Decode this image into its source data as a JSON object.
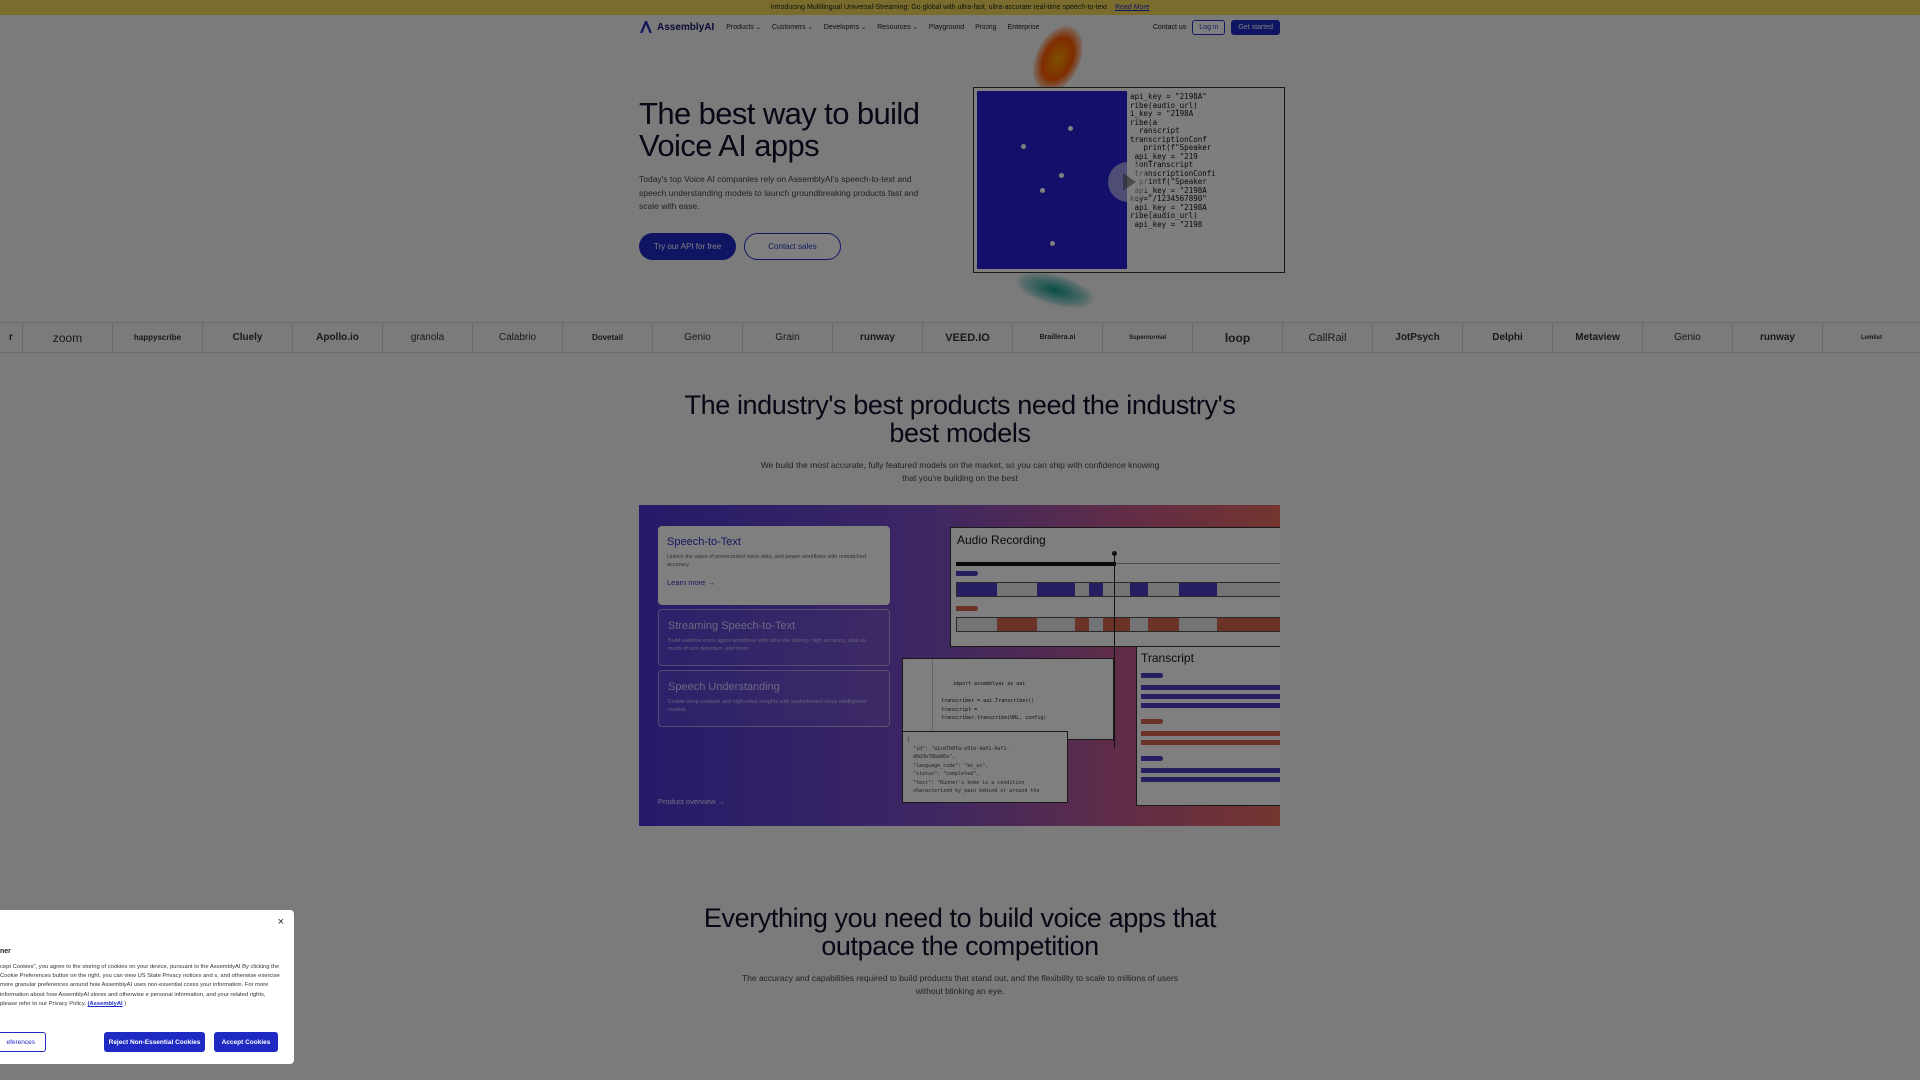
{
  "announcement": {
    "text": "Introducing Multilingual Universal-Streaming: Go global with ultra-fast, ultra-accurate real-time speech-to-text",
    "link": "Read More"
  },
  "nav": {
    "brand": "AssemblyAI",
    "items": [
      "Products",
      "Customers",
      "Developers",
      "Resources",
      "Playground",
      "Pricing",
      "Enterprise"
    ],
    "contact": "Contact us",
    "login": "Log in",
    "get_started": "Get started"
  },
  "hero": {
    "title": "The best way to build Voice AI apps",
    "subtitle": "Today's top Voice AI companies rely on AssemblyAI's speech-to-text and speech understanding models to launch groundbreaking products fast and scale with ease.",
    "cta_primary": "Try our API for free",
    "cta_secondary": "Contact sales",
    "code_text": "api_key = \"2198A\"\nribe(audio_url)\ni_key = \"2198A\nribe(a\n  ranscript\ntranscriptionConf\n   print(f\"Speaker\n api_key = \"219\n ionTranscript\n transcriptionConfi\n  printf(\"Speaker\n api_key = \"2198A\nkey=\"/1234567890\"\n api_key = \"2198A\nribe(audio_url)\n api_key = \"2198"
  },
  "logos": [
    "r",
    "zoom",
    "happyscribe",
    "Cluely",
    "Apollo.io",
    "granola",
    "Calabrio",
    "Dovetail",
    "Genio",
    "Grain",
    "runway",
    "VEED.IO",
    "Braillera.ai",
    "Supernormal",
    "loop",
    "CallRail",
    "JotPsych",
    "Delphi",
    "Metaview",
    "Genio",
    "runway",
    "Lemlist"
  ],
  "section2": {
    "title": "The industry's best products need the industry's best models",
    "subtitle": "We build the most accurate, fully featured models on the market, so you can ship with confidence knowing that you're building on the best",
    "cards": [
      {
        "title": "Speech-to-Text",
        "desc": "Unlock the value of prerecorded voice data, and power workflows with unmatched accuracy.",
        "link": "Learn more →"
      },
      {
        "title": "Streaming Speech-to-Text",
        "desc": "Build realtime voice agent workflows with ultra-low latency, high accuracy, plus as much of turn detection, and more."
      },
      {
        "title": "Speech Understanding",
        "desc": "Enable deep analysis and high-value insights with sophisticated voice intelligence models."
      }
    ],
    "product_overview": "Product overview →",
    "audio_title": "Audio Recording",
    "transcript_title": "Transcript",
    "code_text": "import assemblyai as aai\n\ntranscriber = aai.Transcriber()\ntranscript =\ntranscriber.transcribe(URL, config)\n\nprint(transcript)",
    "output_text": "{\n  \"id\": \"a1cd7b8fa-e91b-4a01-9af1-\n  d0d3b78ba86e\",\n  \"language_code\": \"en_us\",\n  \"status\": \"completed\",\n  \"text\": \"Runner's knee is a condition\n  characterized by pain behind or around the"
  },
  "section3": {
    "title": "Everything you need to build voice apps that outpace the competition",
    "subtitle": "The accuracy and capabilities required to build products that stand out, and the flexibility to scale to millions of users without blinking an eye."
  },
  "cookie": {
    "heading": "ner",
    "body": "cept Cookies\", you agree to the storing of cookies on your device, pursuant to the AssemblyAI By clicking the Cookie Preferences button on the right, you can view US State Privacy notices and s, and otherwise exercise more granular preferences around how AssemblyAI uses non-essential ccess your information. For more information about how AssemblyAI stores and otherwise e personal information, and your related rights, please refer to our Privacy Policy.",
    "link": "(AssemblyAI",
    "link_tail": ")",
    "preferences": "eferences",
    "reject": "Reject Non-Essential Cookies",
    "accept": "Accept Cookies",
    "close": "×"
  },
  "colors": {
    "brand_blue": "#1f2ac4",
    "announcement_bg": "#f3d85a",
    "product_purple": "#4b36d4",
    "product_coral": "#e86b5f"
  }
}
